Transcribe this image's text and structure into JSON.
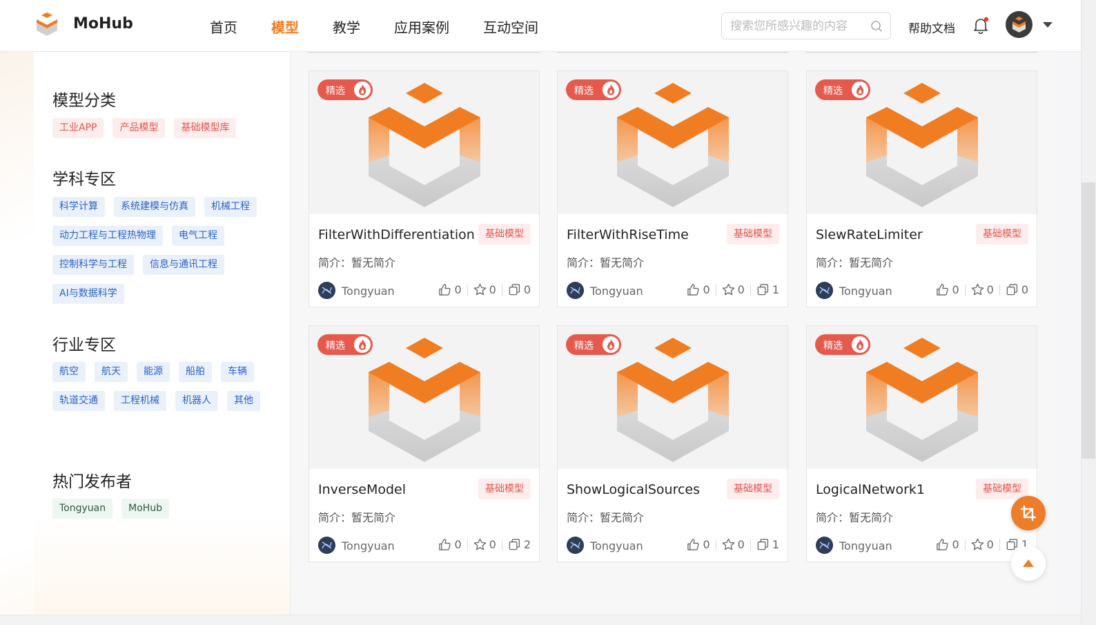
{
  "header": {
    "brand": "MoHub",
    "nav": [
      "首页",
      "模型",
      "教学",
      "应用案例",
      "互动空间"
    ],
    "active_nav": "模型",
    "search_placeholder": "搜索您所感兴趣的内容",
    "help": "帮助文档"
  },
  "sidebar": {
    "category_title": "模型分类",
    "category_tags": [
      "工业APP",
      "产品模型",
      "基础模型库"
    ],
    "discipline_title": "学科专区",
    "discipline_tags": [
      "科学计算",
      "系统建模与仿真",
      "机械工程",
      "动力工程与工程热物理",
      "电气工程",
      "控制科学与工程",
      "信息与通讯工程",
      "AI与数据科学"
    ],
    "industry_title": "行业专区",
    "industry_tags": [
      "航空",
      "航天",
      "能源",
      "船舶",
      "车辆",
      "轨道交通",
      "工程机械",
      "机器人",
      "其他"
    ],
    "publisher_title": "热门发布者",
    "publisher_tags": [
      "Tongyuan",
      "MoHub"
    ]
  },
  "cards": [
    {
      "badge": "精选",
      "title": "FilterWithDifferentiation",
      "type": "基础模型",
      "desc": "简介：暂无简介",
      "author": "Tongyuan",
      "likes": "0",
      "stars": "0",
      "copies": "0"
    },
    {
      "badge": "精选",
      "title": "FilterWithRiseTime",
      "type": "基础模型",
      "desc": "简介：暂无简介",
      "author": "Tongyuan",
      "likes": "0",
      "stars": "0",
      "copies": "1"
    },
    {
      "badge": "精选",
      "title": "SlewRateLimiter",
      "type": "基础模型",
      "desc": "简介：暂无简介",
      "author": "Tongyuan",
      "likes": "0",
      "stars": "0",
      "copies": "0"
    },
    {
      "badge": "精选",
      "title": "InverseModel",
      "type": "基础模型",
      "desc": "简介：暂无简介",
      "author": "Tongyuan",
      "likes": "0",
      "stars": "0",
      "copies": "2"
    },
    {
      "badge": "精选",
      "title": "ShowLogicalSources",
      "type": "基础模型",
      "desc": "简介：暂无简介",
      "author": "Tongyuan",
      "likes": "0",
      "stars": "0",
      "copies": "1"
    },
    {
      "badge": "精选",
      "title": "LogicalNetwork1",
      "type": "基础模型",
      "desc": "简介：暂无简介",
      "author": "Tongyuan",
      "likes": "0",
      "stars": "0",
      "copies": "1"
    }
  ],
  "colors": {
    "accent": "#f07d22",
    "badge": "#e65a4d",
    "tag_blue": "#2a62c9"
  },
  "icons": {
    "search": "search-icon",
    "bell": "bell-icon",
    "like": "thumbs-up-icon",
    "star": "star-icon",
    "copy": "copy-icon",
    "fire": "fire-icon"
  }
}
